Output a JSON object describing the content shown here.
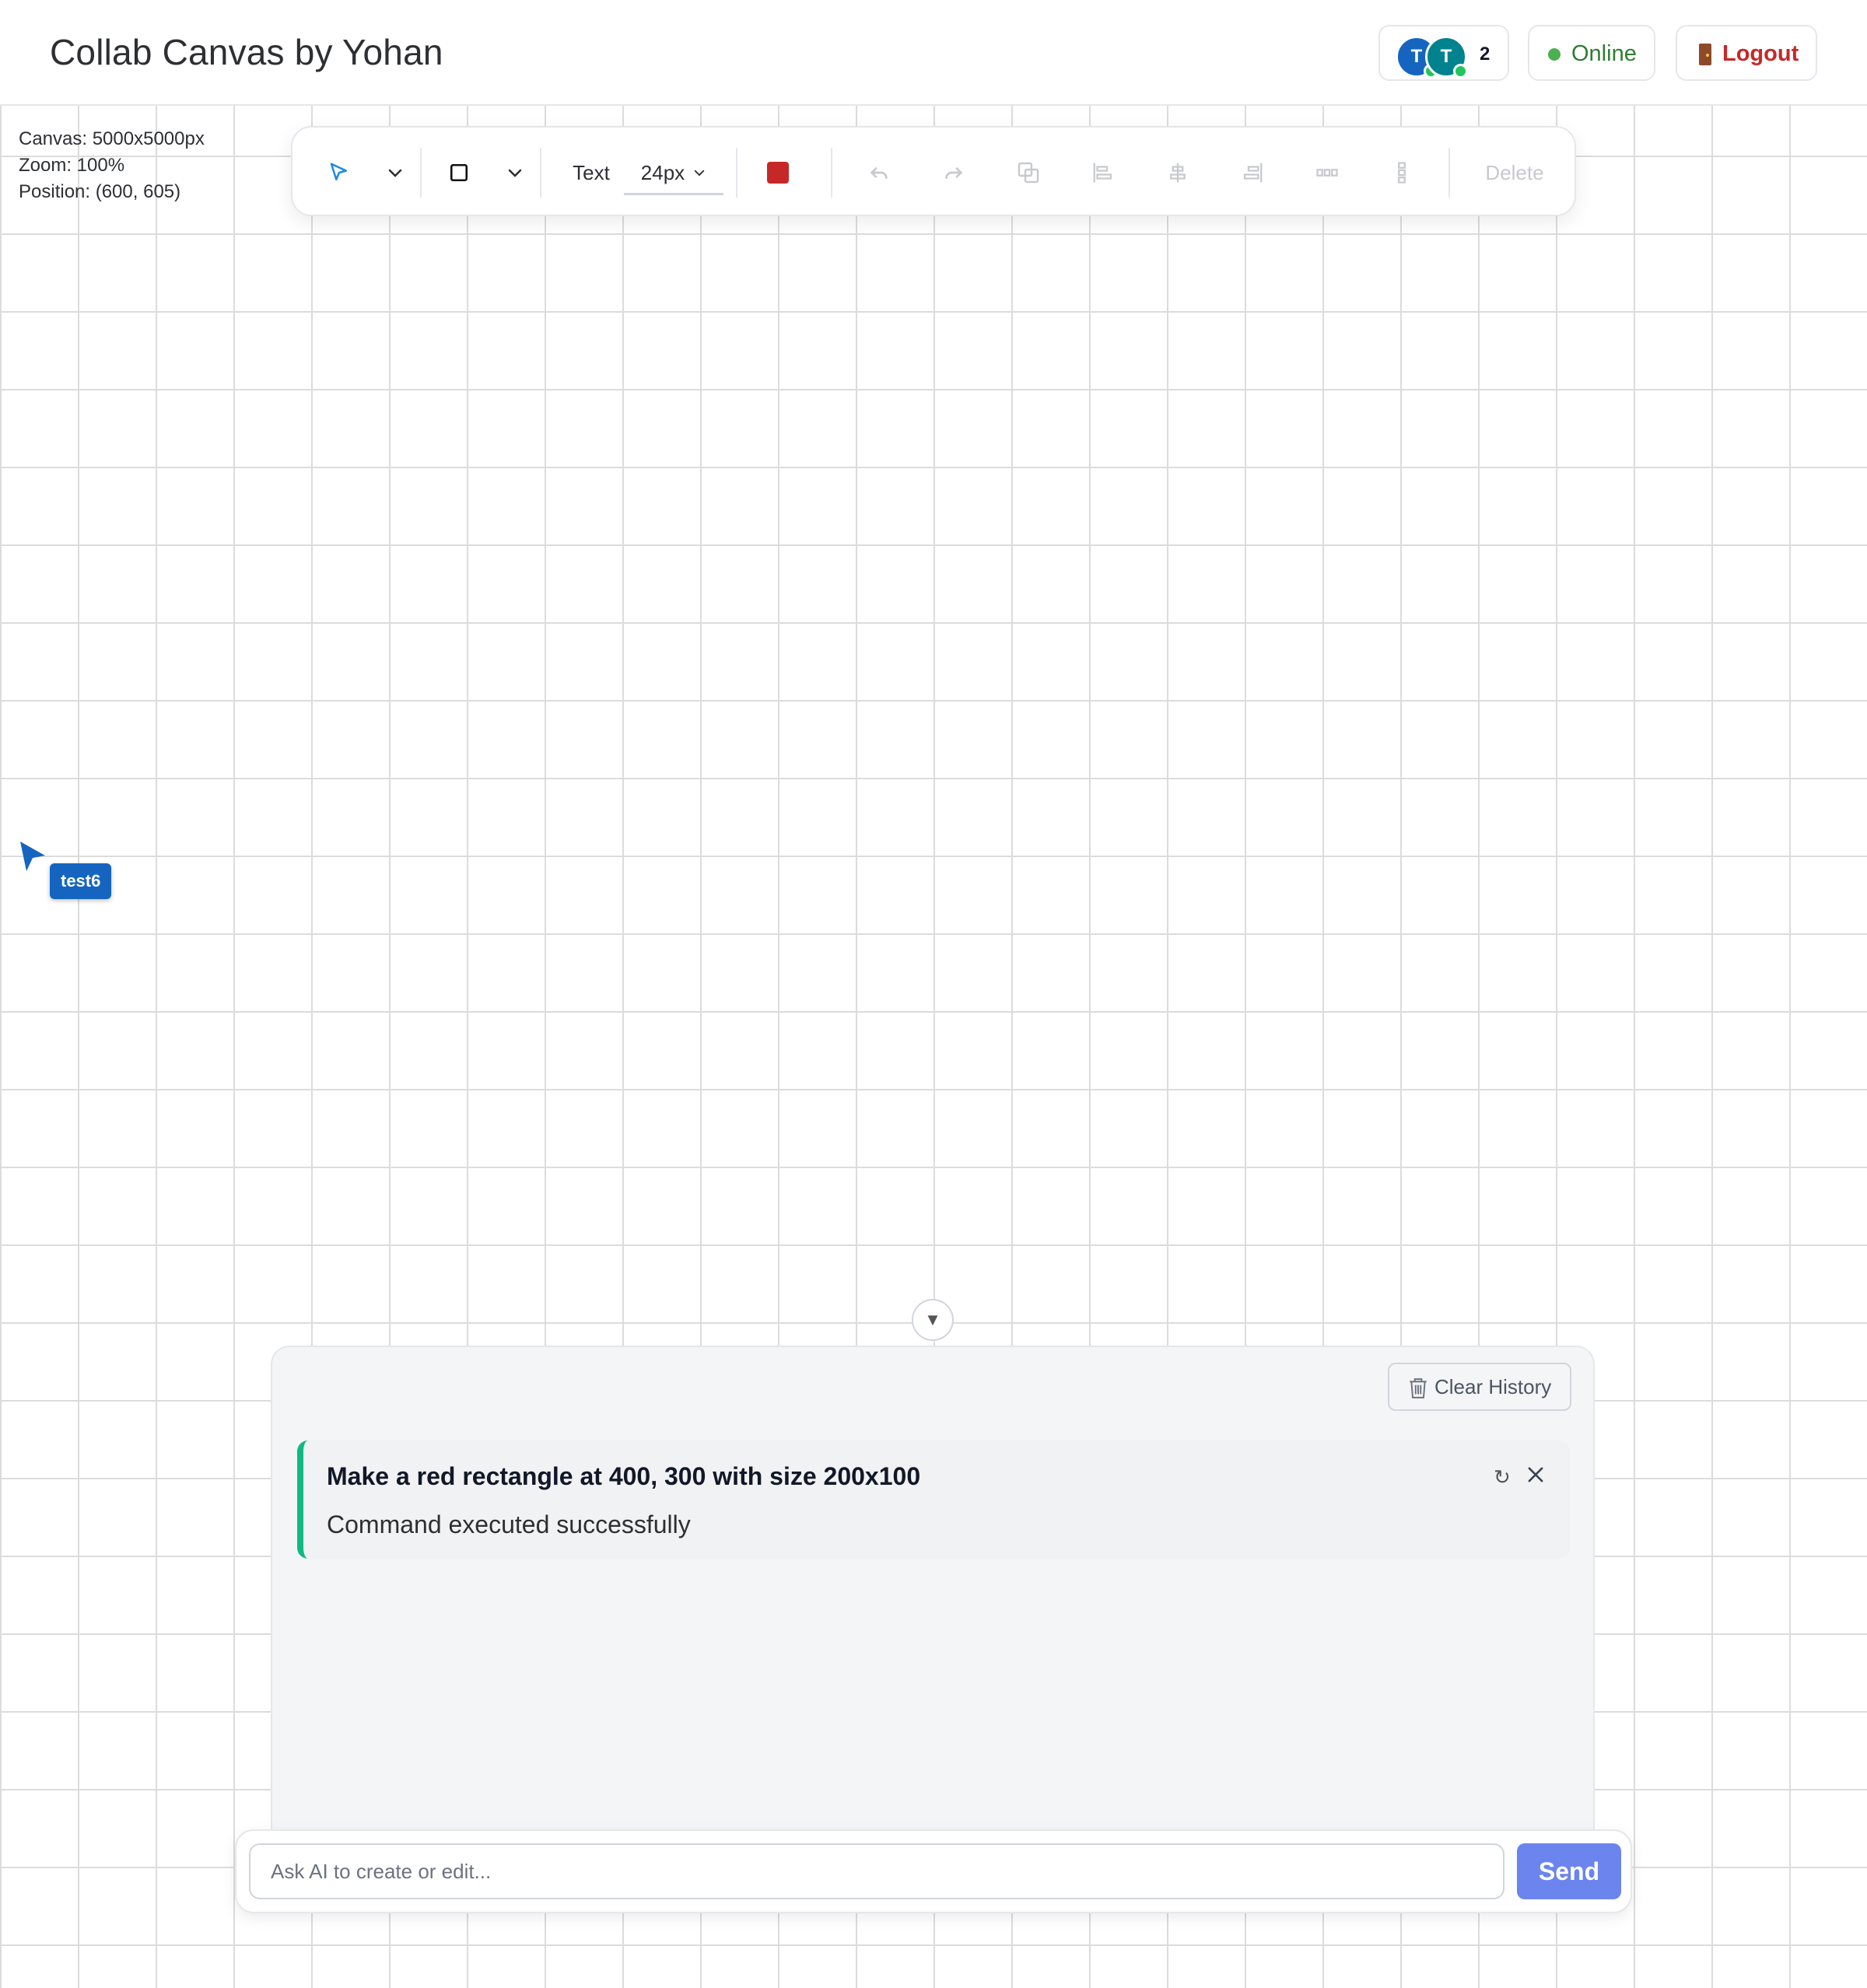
{
  "header": {
    "title": "Collab Canvas by Yohan",
    "presence": {
      "users": [
        {
          "initial": "T",
          "color": "#1565c0"
        },
        {
          "initial": "T",
          "color": "#00838f"
        }
      ],
      "count": "2"
    },
    "status": {
      "label": "Online",
      "color": "#4caf50"
    },
    "logout": {
      "label": "Logout",
      "icon": "door-icon"
    }
  },
  "canvas_info": {
    "canvas": "Canvas: 5000x5000px",
    "zoom": "Zoom: 100%",
    "position": "Position: (600, 605)"
  },
  "toolbar": {
    "select_icon": "pointer-arrow-icon",
    "shape_icon": "rectangle-icon",
    "text_label": "Text",
    "font_size": "24px",
    "color": "#c62828",
    "disabled_tools": [
      "undo-icon",
      "redo-icon",
      "duplicate-icon",
      "align-left-icon",
      "align-center-icon",
      "align-right-icon",
      "distribute-horizontal-icon",
      "distribute-vertical-icon"
    ],
    "delete_label": "Delete"
  },
  "remote_cursor": {
    "user": "test6",
    "color": "#1565c0"
  },
  "ai_panel": {
    "clear_label": "Clear History",
    "history": [
      {
        "command": "Make a red rectangle at 400, 300 with size 200x100",
        "result": "Command executed successfully",
        "status_color": "#10b981"
      }
    ],
    "input_placeholder": "Ask AI to create or edit...",
    "send_label": "Send"
  }
}
